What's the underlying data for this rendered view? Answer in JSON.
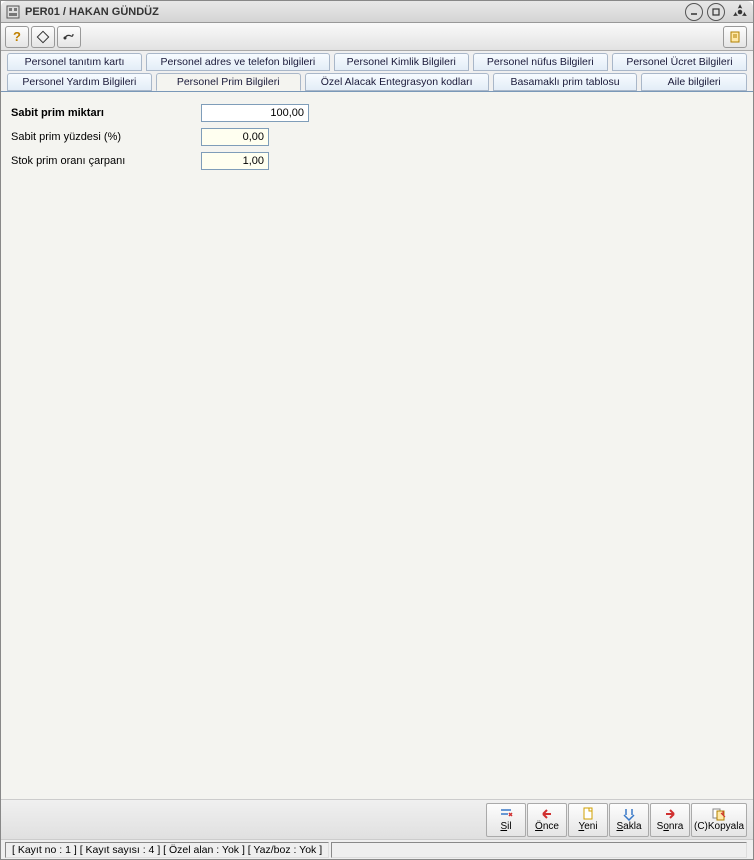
{
  "window": {
    "title": "PER01 / HAKAN GÜNDÜZ"
  },
  "tabs_row1": [
    {
      "label": "Personel tanıtım kartı"
    },
    {
      "label": "Personel adres ve telefon bilgileri"
    },
    {
      "label": "Personel Kimlik Bilgileri"
    },
    {
      "label": "Personel nüfus Bilgileri"
    },
    {
      "label": "Personel Ücret Bilgileri"
    }
  ],
  "tabs_row2": [
    {
      "label": "Personel Yardım Bilgileri"
    },
    {
      "label": "Personel Prim Bilgileri",
      "active": true
    },
    {
      "label": "Özel Alacak Entegrasyon kodları"
    },
    {
      "label": "Basamaklı prim tablosu"
    },
    {
      "label": "Aile bilgileri"
    }
  ],
  "form": {
    "sabit_prim_miktari_label": "Sabit prim miktarı",
    "sabit_prim_miktari_value": "100,00",
    "sabit_prim_yuzdesi_label": "Sabit prim yüzdesi (%)",
    "sabit_prim_yuzdesi_value": "0,00",
    "stok_prim_orani_label": "Stok prim oranı çarpanı",
    "stok_prim_orani_value": "1,00"
  },
  "actions": {
    "sil": "Sil",
    "once": "Önce",
    "yeni": "Yeni",
    "sakla": "Sakla",
    "sonra": "Sonra",
    "kopyala": "(C)Kopyala"
  },
  "status": {
    "text": "[ Kayıt no : 1 ] [ Kayıt sayısı : 4 ] [ Özel alan : Yok ] [ Yaz/boz : Yok ]"
  }
}
